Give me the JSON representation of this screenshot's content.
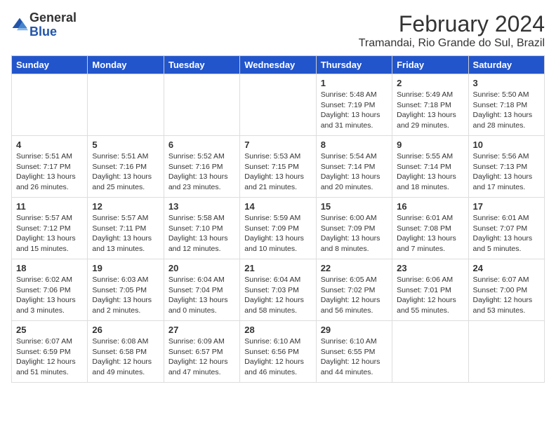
{
  "logo": {
    "general": "General",
    "blue": "Blue"
  },
  "header": {
    "title": "February 2024",
    "subtitle": "Tramandai, Rio Grande do Sul, Brazil"
  },
  "days": [
    "Sunday",
    "Monday",
    "Tuesday",
    "Wednesday",
    "Thursday",
    "Friday",
    "Saturday"
  ],
  "weeks": [
    [
      {
        "day": "",
        "content": ""
      },
      {
        "day": "",
        "content": ""
      },
      {
        "day": "",
        "content": ""
      },
      {
        "day": "",
        "content": ""
      },
      {
        "day": "1",
        "content": "Sunrise: 5:48 AM\nSunset: 7:19 PM\nDaylight: 13 hours\nand 31 minutes."
      },
      {
        "day": "2",
        "content": "Sunrise: 5:49 AM\nSunset: 7:18 PM\nDaylight: 13 hours\nand 29 minutes."
      },
      {
        "day": "3",
        "content": "Sunrise: 5:50 AM\nSunset: 7:18 PM\nDaylight: 13 hours\nand 28 minutes."
      }
    ],
    [
      {
        "day": "4",
        "content": "Sunrise: 5:51 AM\nSunset: 7:17 PM\nDaylight: 13 hours\nand 26 minutes."
      },
      {
        "day": "5",
        "content": "Sunrise: 5:51 AM\nSunset: 7:16 PM\nDaylight: 13 hours\nand 25 minutes."
      },
      {
        "day": "6",
        "content": "Sunrise: 5:52 AM\nSunset: 7:16 PM\nDaylight: 13 hours\nand 23 minutes."
      },
      {
        "day": "7",
        "content": "Sunrise: 5:53 AM\nSunset: 7:15 PM\nDaylight: 13 hours\nand 21 minutes."
      },
      {
        "day": "8",
        "content": "Sunrise: 5:54 AM\nSunset: 7:14 PM\nDaylight: 13 hours\nand 20 minutes."
      },
      {
        "day": "9",
        "content": "Sunrise: 5:55 AM\nSunset: 7:14 PM\nDaylight: 13 hours\nand 18 minutes."
      },
      {
        "day": "10",
        "content": "Sunrise: 5:56 AM\nSunset: 7:13 PM\nDaylight: 13 hours\nand 17 minutes."
      }
    ],
    [
      {
        "day": "11",
        "content": "Sunrise: 5:57 AM\nSunset: 7:12 PM\nDaylight: 13 hours\nand 15 minutes."
      },
      {
        "day": "12",
        "content": "Sunrise: 5:57 AM\nSunset: 7:11 PM\nDaylight: 13 hours\nand 13 minutes."
      },
      {
        "day": "13",
        "content": "Sunrise: 5:58 AM\nSunset: 7:10 PM\nDaylight: 13 hours\nand 12 minutes."
      },
      {
        "day": "14",
        "content": "Sunrise: 5:59 AM\nSunset: 7:09 PM\nDaylight: 13 hours\nand 10 minutes."
      },
      {
        "day": "15",
        "content": "Sunrise: 6:00 AM\nSunset: 7:09 PM\nDaylight: 13 hours\nand 8 minutes."
      },
      {
        "day": "16",
        "content": "Sunrise: 6:01 AM\nSunset: 7:08 PM\nDaylight: 13 hours\nand 7 minutes."
      },
      {
        "day": "17",
        "content": "Sunrise: 6:01 AM\nSunset: 7:07 PM\nDaylight: 13 hours\nand 5 minutes."
      }
    ],
    [
      {
        "day": "18",
        "content": "Sunrise: 6:02 AM\nSunset: 7:06 PM\nDaylight: 13 hours\nand 3 minutes."
      },
      {
        "day": "19",
        "content": "Sunrise: 6:03 AM\nSunset: 7:05 PM\nDaylight: 13 hours\nand 2 minutes."
      },
      {
        "day": "20",
        "content": "Sunrise: 6:04 AM\nSunset: 7:04 PM\nDaylight: 13 hours\nand 0 minutes."
      },
      {
        "day": "21",
        "content": "Sunrise: 6:04 AM\nSunset: 7:03 PM\nDaylight: 12 hours\nand 58 minutes."
      },
      {
        "day": "22",
        "content": "Sunrise: 6:05 AM\nSunset: 7:02 PM\nDaylight: 12 hours\nand 56 minutes."
      },
      {
        "day": "23",
        "content": "Sunrise: 6:06 AM\nSunset: 7:01 PM\nDaylight: 12 hours\nand 55 minutes."
      },
      {
        "day": "24",
        "content": "Sunrise: 6:07 AM\nSunset: 7:00 PM\nDaylight: 12 hours\nand 53 minutes."
      }
    ],
    [
      {
        "day": "25",
        "content": "Sunrise: 6:07 AM\nSunset: 6:59 PM\nDaylight: 12 hours\nand 51 minutes."
      },
      {
        "day": "26",
        "content": "Sunrise: 6:08 AM\nSunset: 6:58 PM\nDaylight: 12 hours\nand 49 minutes."
      },
      {
        "day": "27",
        "content": "Sunrise: 6:09 AM\nSunset: 6:57 PM\nDaylight: 12 hours\nand 47 minutes."
      },
      {
        "day": "28",
        "content": "Sunrise: 6:10 AM\nSunset: 6:56 PM\nDaylight: 12 hours\nand 46 minutes."
      },
      {
        "day": "29",
        "content": "Sunrise: 6:10 AM\nSunset: 6:55 PM\nDaylight: 12 hours\nand 44 minutes."
      },
      {
        "day": "",
        "content": ""
      },
      {
        "day": "",
        "content": ""
      }
    ]
  ]
}
